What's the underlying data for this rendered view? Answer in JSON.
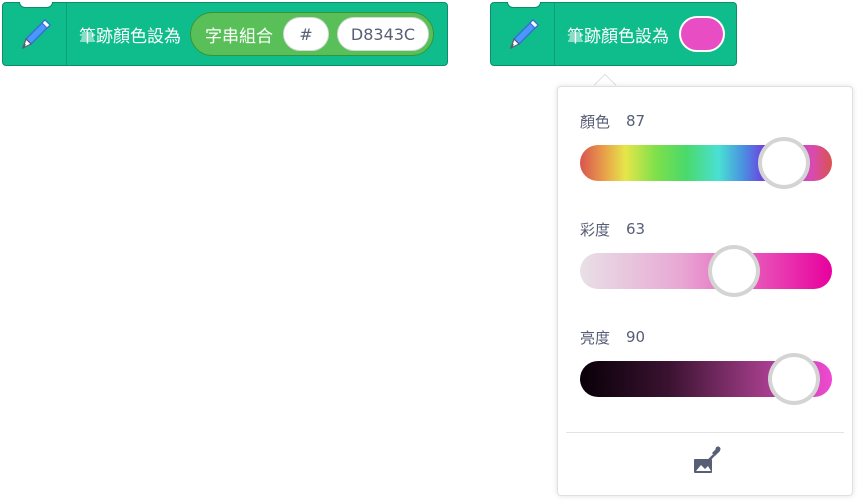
{
  "block_one": {
    "icon": "pen-icon",
    "label": "筆跡顏色設為",
    "join": {
      "label": "字串組合",
      "input_a": "#",
      "input_b": "D8343C"
    }
  },
  "block_two": {
    "icon": "pen-icon",
    "label": "筆跡顏色設為",
    "swatch_color": "#e94dc3"
  },
  "picker": {
    "rows": [
      {
        "label": "顏色",
        "value": "87",
        "fraction": 0.81
      },
      {
        "label": "彩度",
        "value": "63",
        "fraction": 0.61
      },
      {
        "label": "亮度",
        "value": "90",
        "fraction": 0.85
      }
    ],
    "eyedropper_icon": "eyedropper-icon"
  },
  "colors": {
    "block_bg": "#0fbd8c",
    "reporter_bg": "#59c059",
    "text": "#575e75"
  }
}
